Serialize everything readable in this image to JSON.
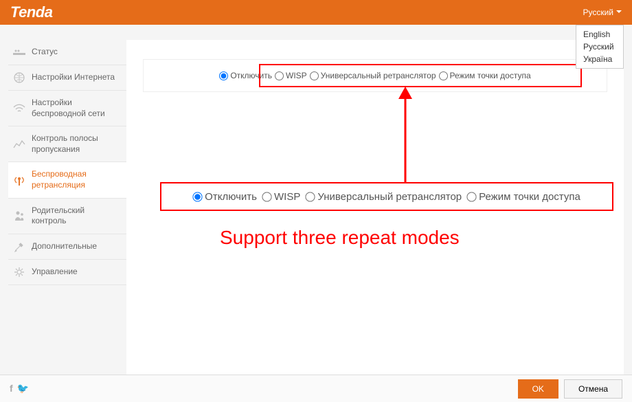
{
  "header": {
    "brand": "Tenda",
    "language_current": "Русский",
    "language_options": [
      "English",
      "Русский",
      "Україна"
    ]
  },
  "sidebar": {
    "items": [
      {
        "label": "Статус",
        "icon": "status-icon"
      },
      {
        "label": "Настройки Интернета",
        "icon": "globe-icon"
      },
      {
        "label": "Настройки беспроводной сети",
        "icon": "wifi-icon"
      },
      {
        "label": "Контроль полосы пропускания",
        "icon": "bandwidth-icon"
      },
      {
        "label": "Беспроводная ретрансляция",
        "icon": "repeater-icon",
        "active": true
      },
      {
        "label": "Родительский контроль",
        "icon": "parent-icon"
      },
      {
        "label": "Дополнительные",
        "icon": "tools-icon"
      },
      {
        "label": "Управление",
        "icon": "gear-icon"
      }
    ]
  },
  "panel": {
    "options": [
      {
        "label": "Отключить",
        "checked": true
      },
      {
        "label": "WISP",
        "checked": false
      },
      {
        "label": "Универсальный ретранслятор",
        "checked": false
      },
      {
        "label": "Режим точки доступа",
        "checked": false
      }
    ]
  },
  "annotation": {
    "caption": "Support three repeat modes"
  },
  "footer": {
    "ok_label": "OK",
    "cancel_label": "Отмена"
  }
}
